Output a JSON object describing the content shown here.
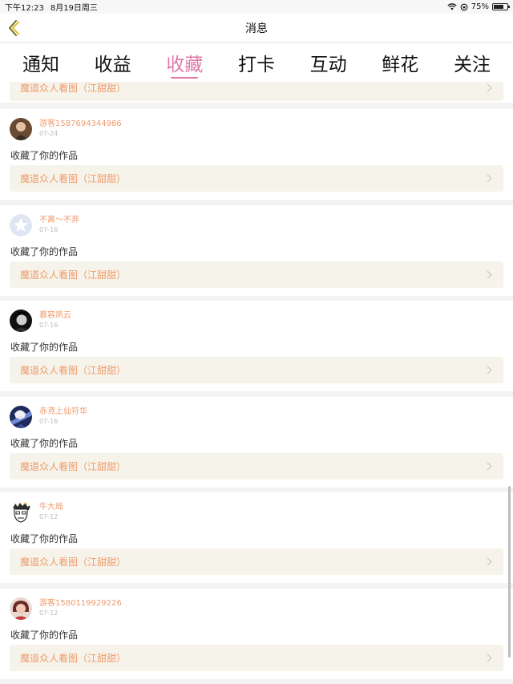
{
  "status": {
    "time": "下午12:23",
    "date": "8月19日周三",
    "battery": "75%",
    "battery_level": 0.75
  },
  "header": {
    "title": "消息"
  },
  "tabs": [
    {
      "label": "通知"
    },
    {
      "label": "收益"
    },
    {
      "label": "收藏",
      "active": true
    },
    {
      "label": "打卡"
    },
    {
      "label": "互动"
    },
    {
      "label": "鲜花"
    },
    {
      "label": "关注"
    }
  ],
  "partial_card": {
    "work": "魔道众人看图（江甜甜）"
  },
  "items": [
    {
      "user": "游客1587694344986",
      "date": "07-24",
      "action": "收藏了你的作品",
      "work": "魔道众人看图（江甜甜）",
      "avatar": "portrait-dark"
    },
    {
      "user": "不离～不弃",
      "date": "07-16",
      "action": "收藏了你的作品",
      "work": "魔道众人看图（江甜甜）",
      "avatar": "default-star"
    },
    {
      "user": "慕容夙云",
      "date": "07-16",
      "action": "收藏了你的作品",
      "work": "魔道众人看图（江甜甜）",
      "avatar": "portrait-black"
    },
    {
      "user": "赤鸢上仙符华",
      "date": "07-16",
      "action": "收藏了你的作品",
      "work": "魔道众人看图（江甜甜）",
      "avatar": "anime-blue"
    },
    {
      "user": "牛大局",
      "date": "07-12",
      "action": "收藏了你的作品",
      "work": "魔道众人看图（江甜甜）",
      "avatar": "cartoon-face"
    },
    {
      "user": "游客1580119929226",
      "date": "07-12",
      "action": "收藏了你的作品",
      "work": "魔道众人看图（江甜甜）",
      "avatar": "portrait-red"
    }
  ]
}
